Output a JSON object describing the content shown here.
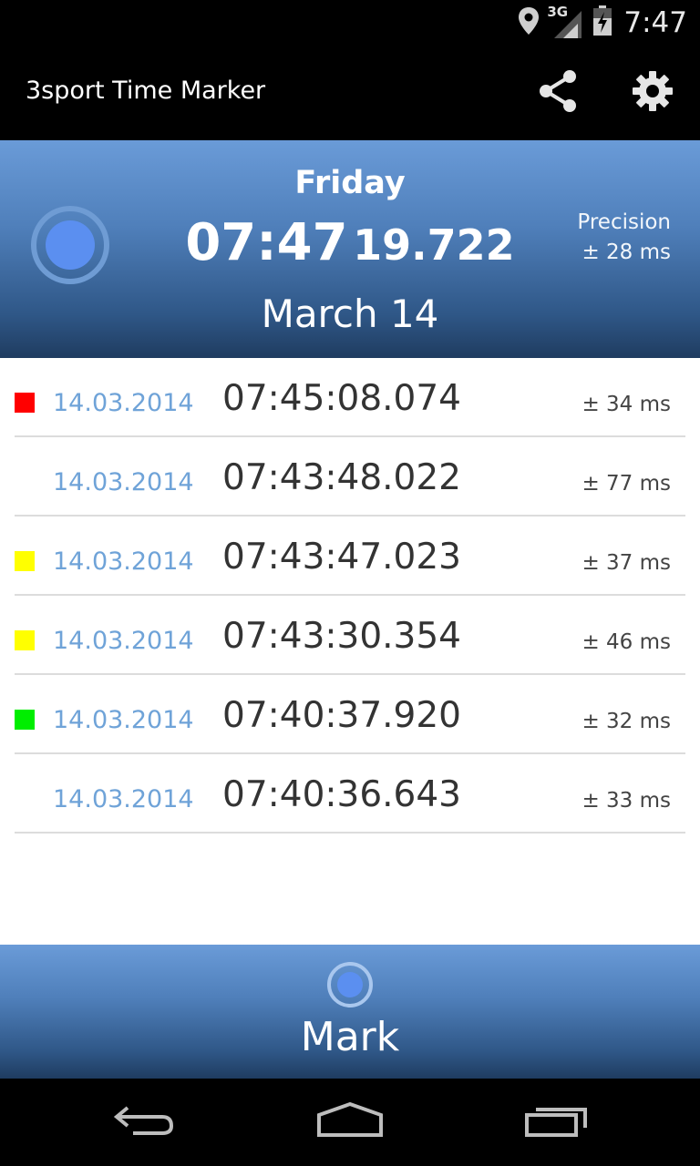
{
  "status_bar": {
    "time": "7:47",
    "network": "3G",
    "icons": [
      "location-icon",
      "signal-icon",
      "battery-icon"
    ]
  },
  "action_bar": {
    "title": "3sport Time Marker",
    "actions": [
      "share-icon",
      "settings-icon"
    ]
  },
  "header": {
    "day": "Friday",
    "time_hm": "07:47",
    "time_sec": "19.722",
    "date": "March 14",
    "precision_label": "Precision",
    "precision_value": "± 28 ms"
  },
  "marks": [
    {
      "color": "#ff0000",
      "date": "14.03.2014",
      "time": "07:45:08.074",
      "precision": "± 34 ms"
    },
    {
      "color": null,
      "date": "14.03.2014",
      "time": "07:43:48.022",
      "precision": "± 77 ms"
    },
    {
      "color": "#ffff00",
      "date": "14.03.2014",
      "time": "07:43:47.023",
      "precision": "± 37 ms"
    },
    {
      "color": "#ffff00",
      "date": "14.03.2014",
      "time": "07:43:30.354",
      "precision": "± 46 ms"
    },
    {
      "color": "#00ee00",
      "date": "14.03.2014",
      "time": "07:40:37.920",
      "precision": "± 32 ms"
    },
    {
      "color": null,
      "date": "14.03.2014",
      "time": "07:40:36.643",
      "precision": "± 33 ms"
    }
  ],
  "mark_button": {
    "label": "Mark"
  },
  "nav_bar": {
    "buttons": [
      "back-icon",
      "home-icon",
      "recent-apps-icon"
    ]
  },
  "colors": {
    "accent_blue": "#6fa3d8",
    "header_top": "#6a9bd8",
    "header_bottom": "#1f3c60"
  }
}
